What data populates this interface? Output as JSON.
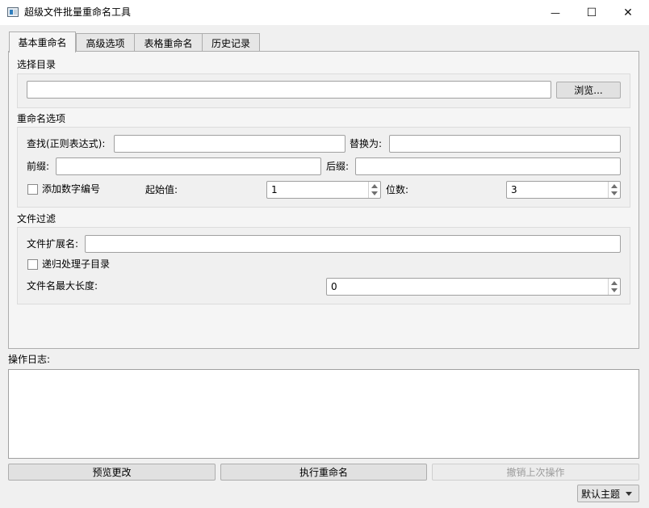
{
  "window": {
    "title": "超级文件批量重命名工具",
    "minimize_glyph": "—",
    "maximize_glyph": "☐",
    "close_glyph": "✕"
  },
  "tabs": [
    {
      "label": "基本重命名",
      "active": true
    },
    {
      "label": "高级选项",
      "active": false
    },
    {
      "label": "表格重命名",
      "active": false
    },
    {
      "label": "历史记录",
      "active": false
    }
  ],
  "directory": {
    "section_label": "选择目录",
    "path_value": "",
    "browse_label": "浏览..."
  },
  "rename": {
    "section_label": "重命名选项",
    "find_label": "查找(正则表达式):",
    "find_value": "",
    "replace_label": "替换为:",
    "replace_value": "",
    "prefix_label": "前缀:",
    "prefix_value": "",
    "suffix_label": "后缀:",
    "suffix_value": "",
    "numbering_label": "添加数字编号",
    "numbering_checked": false,
    "start_label": "起始值:",
    "start_value": "1",
    "digits_label": "位数:",
    "digits_value": "3"
  },
  "filter": {
    "section_label": "文件过滤",
    "ext_label": "文件扩展名:",
    "ext_value": "",
    "recursive_label": "递归处理子目录",
    "recursive_checked": false,
    "maxlen_label": "文件名最大长度:",
    "maxlen_value": "0"
  },
  "log": {
    "label": "操作日志:",
    "content": ""
  },
  "actions": {
    "preview_label": "预览更改",
    "execute_label": "执行重命名",
    "undo_label": "撤销上次操作"
  },
  "theme": {
    "selected": "默认主题"
  }
}
